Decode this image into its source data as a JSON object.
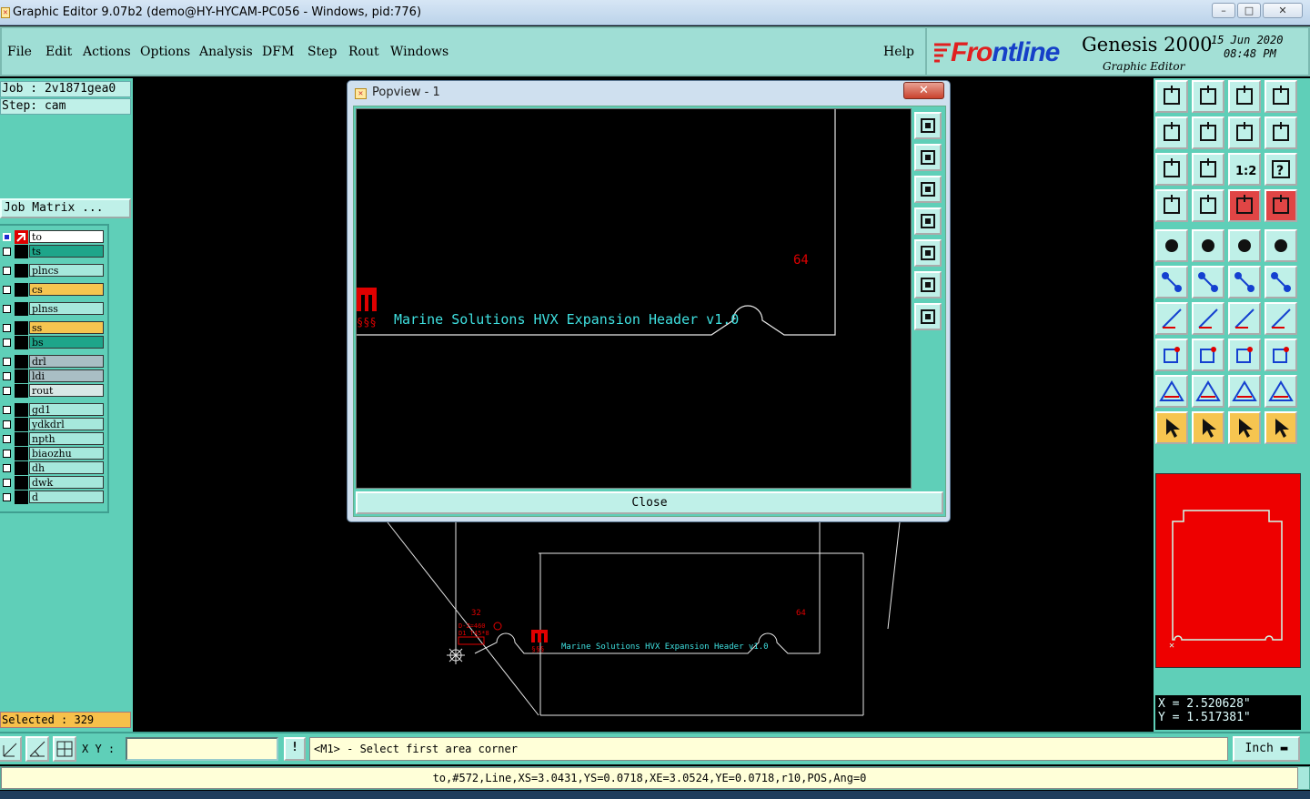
{
  "window": {
    "title": "Graphic Editor 9.07b2 (demo@HY-HYCAM-PC056 - Windows, pid:776)",
    "minimize": "–",
    "maximize": "□",
    "close": "✕"
  },
  "menubar": {
    "items": [
      "File",
      "Edit",
      "Actions",
      "Options",
      "Analysis",
      "DFM",
      "Step",
      "Rout",
      "Windows"
    ],
    "help": "Help"
  },
  "brand": {
    "logo_prefix": "Fr",
    "logo_o": "o",
    "logo_suffix": "ntline",
    "product": "Genesis 2000",
    "subtitle": "Graphic Editor",
    "date": "15 Jun 2020",
    "time": "08:48 PM"
  },
  "left": {
    "job": "Job : 2v1871gea0",
    "step": "Step: cam",
    "job_matrix": "Job Matrix ...",
    "layers": [
      {
        "name": "to",
        "color": "#ffffff",
        "active": true
      },
      {
        "name": "ts",
        "color": "#1ea58a"
      },
      {
        "name": "plncs",
        "color": "#a6e8dc"
      },
      {
        "name": "cs",
        "color": "#f6c550"
      },
      {
        "name": "plnss",
        "color": "#a6e8dc"
      },
      {
        "name": "ss",
        "color": "#f6c550"
      },
      {
        "name": "bs",
        "color": "#1ea58a"
      },
      {
        "name": "drl",
        "color": "#a9bec4"
      },
      {
        "name": "ldi",
        "color": "#a9bec4"
      },
      {
        "name": "rout",
        "color": "#d8e8e6"
      },
      {
        "name": "gd1",
        "color": "#a6e8dc"
      },
      {
        "name": "ydkdrl",
        "color": "#a6e8dc"
      },
      {
        "name": "npth",
        "color": "#a6e8dc"
      },
      {
        "name": "biaozhu",
        "color": "#a6e8dc"
      },
      {
        "name": "dh",
        "color": "#a6e8dc"
      },
      {
        "name": "dwk",
        "color": "#a6e8dc"
      },
      {
        "name": "d",
        "color": "#a6e8dc"
      }
    ],
    "selected": "Selected : 329"
  },
  "canvas": {
    "board_label": "Marine Solutions HVX Expansion Header v1.0",
    "num_32": "32",
    "num_64": "64",
    "small_text_1": "D-Z=460",
    "small_text_2": "D1 T45*8"
  },
  "popview": {
    "title": "Popview - 1",
    "label": "Marine Solutions HVX Expansion Header v1.0",
    "num_64": "64",
    "close_label": "Close",
    "close_x": "✕"
  },
  "right": {
    "coord_x": "X = 2.520628\"",
    "coord_y": "Y = 1.517381\""
  },
  "cmd": {
    "xy_label": "X Y :",
    "xy_value": "",
    "warn": "!",
    "prompt": "<M1> - Select first area corner",
    "unit": "Inch"
  },
  "status": {
    "text": "to,#572,Line,XS=3.0431,YS=0.0718,XE=3.0524,YE=0.0718,r10,POS,Ang=0"
  },
  "colors": {
    "panel": "#5fcfb8",
    "highlight_red": "#e00000",
    "cyan_text": "#3fe0e0"
  }
}
